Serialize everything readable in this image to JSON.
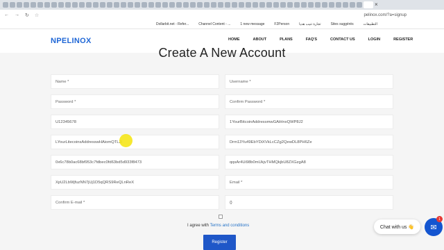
{
  "browser": {
    "url": "pelinox.com/?a=signup",
    "bookmarks": [
      "Dollarbit.net - Refer...",
      "Channel Content - ...",
      "1 new message",
      "F2Person",
      "تجارة تنيب هديا",
      "Sites suggérés",
      "التطبيقات"
    ]
  },
  "header": {
    "logo_text": "PELINOX",
    "menu": [
      "HOME",
      "ABOUT",
      "PLANS",
      "FAQ'S",
      "CONTACT US",
      "LOGIN",
      "REGISTER"
    ]
  },
  "title": "Create A New Account",
  "form": {
    "name_placeholder": "Name *",
    "username_placeholder": "Username *",
    "password_placeholder": "Password *",
    "confirm_password_placeholder": "Confirm Password *",
    "field_5": "U12345678",
    "field_6": "1YourBitcoinAddressmwGAiHnxQWP8J2",
    "field_7": "LYourLitecoinsAddresswHAiomQTL2I",
    "field_8": "Drm13Yu49EbYDiXVkLcCZg2QewDL8PH6Ze",
    "field_9": "0x6c78b0ac68bf953c7fdbec0fd63bd5d933f8473",
    "field_10": "qqsAr4Ui98b0mUkjvTHMQkjbU8ZXGzgA8",
    "field_11": "XpU2LbWjfuzNN7jUj1D5qQRS9ReQLnReX",
    "email_placeholder": "Email *",
    "confirm_email_placeholder": "Confirm E-mail *",
    "field_14": "{}"
  },
  "agree": {
    "text": "I agree with ",
    "link": "Terms and conditions"
  },
  "register_button": "Register",
  "chat": {
    "label": "Chat with us 👋",
    "badge": "1"
  }
}
